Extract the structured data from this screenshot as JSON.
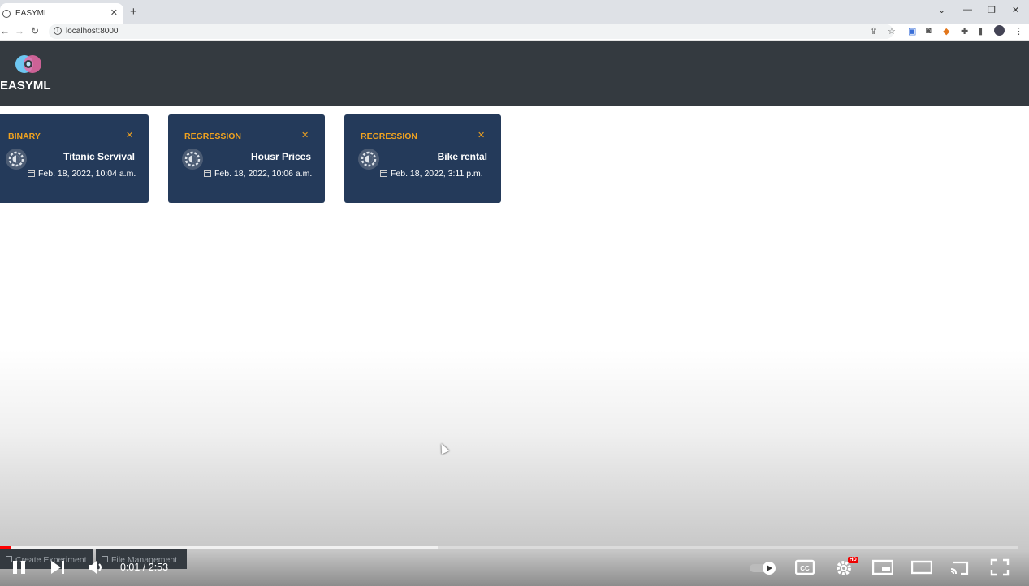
{
  "browser": {
    "tab_title": "EASYML",
    "url": "localhost:8000"
  },
  "app": {
    "brand": "EASYML"
  },
  "cards": [
    {
      "type": "BINARY",
      "title": "Titanic Servival",
      "date": "Feb. 18, 2022, 10:04 a.m."
    },
    {
      "type": "REGRESSION",
      "title": "Housr Prices",
      "date": "Feb. 18, 2022, 10:06 a.m."
    },
    {
      "type": "REGRESSION",
      "title": "Bike rental",
      "date": "Feb. 18, 2022, 3:11 p.m."
    }
  ],
  "footer": {
    "create_label": "Create Experiment",
    "files_label": "File Management"
  },
  "video": {
    "time": "0:01 / 2:53",
    "played_fraction": 0.01,
    "buffered_fraction": 0.43,
    "quality_badge": "HD"
  },
  "colors": {
    "header_bg": "#343a40",
    "card_bg": "#243a5a",
    "accent": "#f0a21f",
    "progress": "#ff0000"
  }
}
